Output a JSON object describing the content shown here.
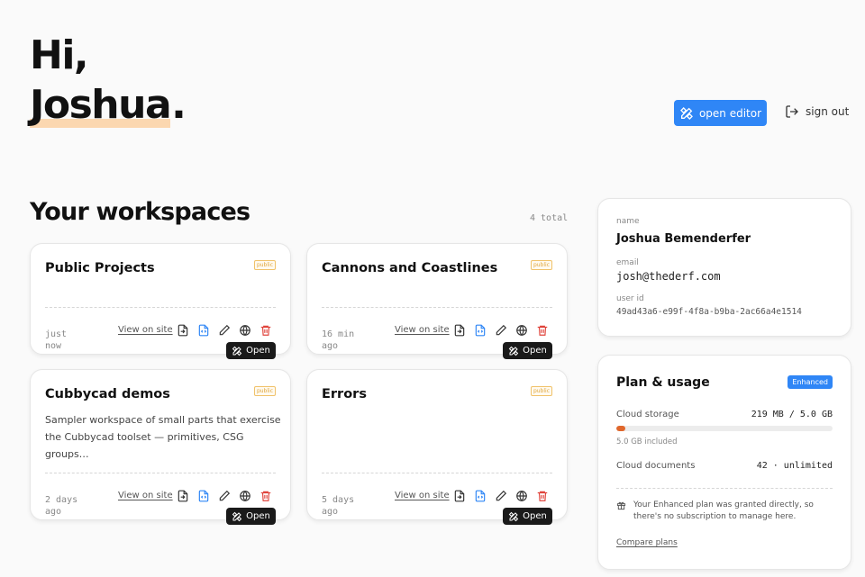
{
  "greeting": {
    "line1": "Hi,",
    "name": "Joshua",
    "dot": "."
  },
  "header": {
    "open_editor": "open editor",
    "sign_out": "sign out"
  },
  "workspaces": {
    "title": "Your workspaces",
    "total": "4 total",
    "view_label": "View on site",
    "open_label": "Open",
    "items": [
      {
        "title": "Public Projects",
        "badge": "public",
        "description": "",
        "updated_line1": "just",
        "updated_line2": "now"
      },
      {
        "title": "Cannons and Coastlines",
        "badge": "public",
        "description": "",
        "updated_line1": "16 min",
        "updated_line2": "ago"
      },
      {
        "title": "Cubbycad demos",
        "badge": "public",
        "description": "Sampler workspace of small parts that exercise the Cubbycad toolset — primitives, CSG groups…",
        "updated_line1": "2 days",
        "updated_line2": "ago"
      },
      {
        "title": "Errors",
        "badge": "public",
        "description": "",
        "updated_line1": "5 days",
        "updated_line2": "ago"
      }
    ]
  },
  "account": {
    "name_label": "name",
    "name": "Joshua Bemenderfer",
    "email_label": "email",
    "email": "josh@thederf.com",
    "userid_label": "user id",
    "user_id": "49ad43a6-e99f-4f8a-b9ba-2ac66a4e1514"
  },
  "plan": {
    "title": "Plan & usage",
    "badge": "Enhanced",
    "storage_label": "Cloud storage",
    "storage_value": "219 MB / 5.0 GB",
    "storage_used_fraction": 0.043,
    "storage_included": "5.0 GB included",
    "docs_label": "Cloud documents",
    "docs_value": "42 · unlimited",
    "note": "Your Enhanced plan was granted directly, so there's no subscription to manage here.",
    "compare": "Compare plans"
  },
  "colors": {
    "accent": "#2f86f6",
    "highlight": "#fbd7b0",
    "storage_bar": "#e0672c",
    "badge": "#e0a63b",
    "delete": "#e0443c"
  }
}
